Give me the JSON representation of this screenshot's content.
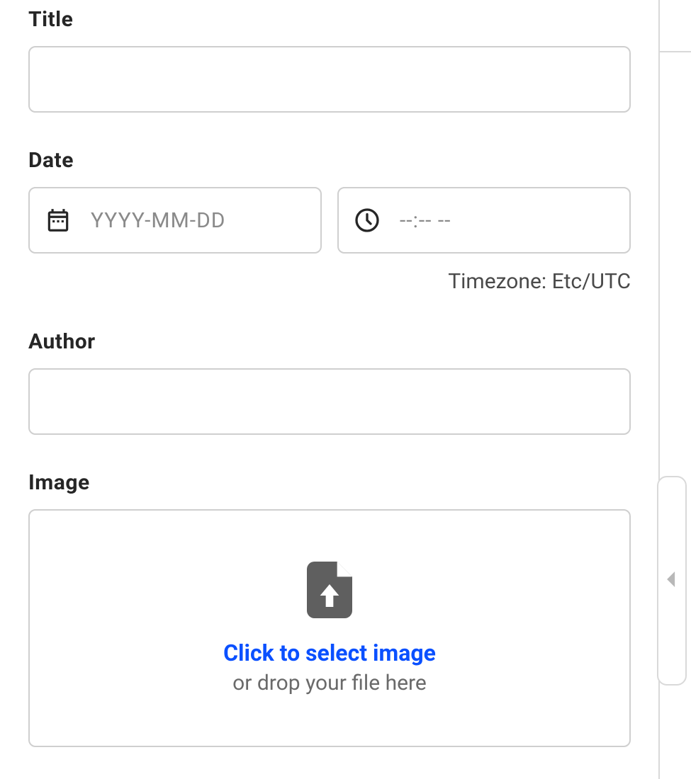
{
  "fields": {
    "title": {
      "label": "Title",
      "value": ""
    },
    "date": {
      "label": "Date",
      "date_value": "",
      "date_placeholder": "YYYY-MM-DD",
      "time_value": "",
      "time_placeholder": "--:--  --",
      "timezone_text": "Timezone: Etc/UTC"
    },
    "author": {
      "label": "Author",
      "value": ""
    },
    "image": {
      "label": "Image",
      "primary": "Click to select image",
      "secondary": "or drop your file here"
    }
  },
  "icons": {
    "calendar": "calendar-icon",
    "clock": "clock-icon",
    "upload": "file-upload-icon",
    "collapse": "chevron-left-icon"
  }
}
